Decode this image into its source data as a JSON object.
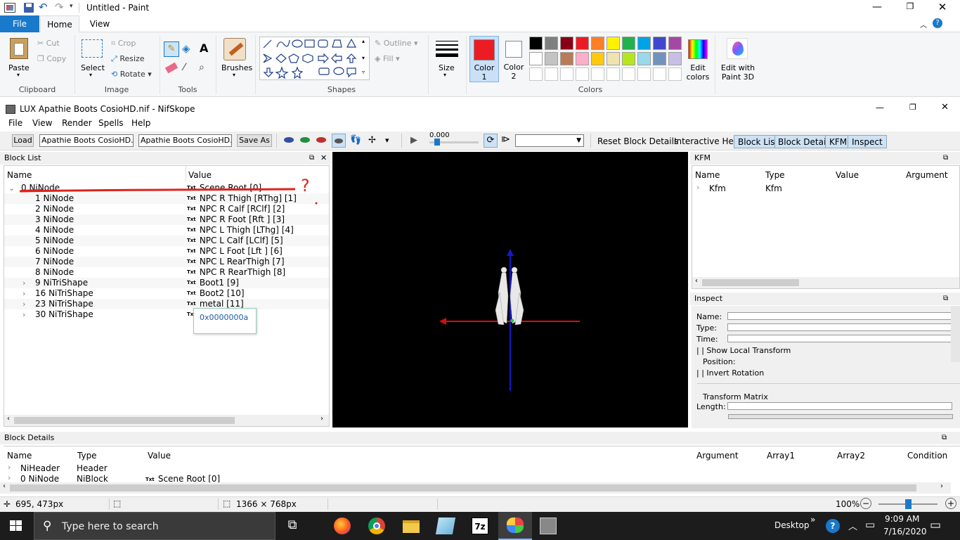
{
  "paint": {
    "title": "Untitled - Paint",
    "tabs": {
      "file": "File",
      "home": "Home",
      "view": "View"
    },
    "clipboard": {
      "paste": "Paste",
      "cut": "Cut",
      "copy": "Copy",
      "label": "Clipboard"
    },
    "image": {
      "select": "Select",
      "crop": "Crop",
      "resize": "Resize",
      "rotate": "Rotate",
      "label": "Image"
    },
    "tools": {
      "label": "Tools"
    },
    "brushes": "Brushes",
    "shapes": {
      "outline": "Outline",
      "fill": "Fill",
      "label": "Shapes"
    },
    "size": "Size",
    "color1": {
      "line1": "Color",
      "line2": "1"
    },
    "color2": {
      "line1": "Color",
      "line2": "2"
    },
    "colors_label": "Colors",
    "edit_colors": {
      "line1": "Edit",
      "line2": "colors"
    },
    "edit_paint3d": {
      "line1": "Edit with",
      "line2": "Paint 3D"
    },
    "palette": [
      "#000000",
      "#7f7f7f",
      "#880015",
      "#ed1c24",
      "#ff7f27",
      "#fff200",
      "#22b14c",
      "#00a2e8",
      "#3f48cc",
      "#a349a4",
      "#ffffff",
      "#c3c3c3",
      "#b97a57",
      "#ffaec9",
      "#ffc90e",
      "#efe4b0",
      "#b5e61d",
      "#99d9ea",
      "#7092be",
      "#c8bfe7"
    ],
    "color1_value": "#ed1c24",
    "status": {
      "coords": "695, 473px",
      "size": "1366 × 768px",
      "zoom": "100%"
    }
  },
  "nifskope": {
    "title": "LUX Apathie Boots CosioHD.nif - NifSkope",
    "menu": [
      "File",
      "View",
      "Render",
      "Spells",
      "Help"
    ],
    "load": "Load",
    "load_field": "Apathie Boots CosioHD.nif",
    "save_field": "Apathie Boots CosioHD.nif",
    "save_as": "Save As",
    "time": "0.000",
    "reset": "Reset Block Details",
    "interactive_help": "Interactive Help",
    "panel_tabs": [
      "Block List",
      "Block Details",
      "KFM",
      "Inspect"
    ],
    "block_list": {
      "title": "Block List",
      "col_name": "Name",
      "col_value": "Value",
      "rows": [
        {
          "name": "0 NiNode",
          "value": "Scene Root [0]",
          "exp": "v"
        },
        {
          "name": "1 NiNode",
          "value": "NPC R Thigh [RThg] [1]",
          "exp": ""
        },
        {
          "name": "2 NiNode",
          "value": "NPC R Calf [RClf] [2]",
          "exp": ""
        },
        {
          "name": "3 NiNode",
          "value": "NPC R Foot [Rft ] [3]",
          "exp": ""
        },
        {
          "name": "4 NiNode",
          "value": "NPC L Thigh [LThg] [4]",
          "exp": ""
        },
        {
          "name": "5 NiNode",
          "value": "NPC L Calf [LClf] [5]",
          "exp": ""
        },
        {
          "name": "6 NiNode",
          "value": "NPC L Foot [Lft ] [6]",
          "exp": ""
        },
        {
          "name": "7 NiNode",
          "value": "NPC L RearThigh [7]",
          "exp": ""
        },
        {
          "name": "8 NiNode",
          "value": "NPC R RearThigh [8]",
          "exp": ""
        },
        {
          "name": "9 NiTriShape",
          "value": "Boot1 [9]",
          "exp": ">"
        },
        {
          "name": "16 NiTriShape",
          "value": "Boot2 [10]",
          "exp": ">"
        },
        {
          "name": "23 NiTriShape",
          "value": "metal [11]",
          "exp": ">"
        },
        {
          "name": "30 NiTriShape",
          "value": "",
          "exp": ">"
        }
      ],
      "tooltip": "0x0000000a"
    },
    "kfm": {
      "title": "KFM",
      "cols": [
        "Name",
        "Type",
        "Value",
        "Argument"
      ],
      "row": {
        "name": "Kfm",
        "type": "Kfm"
      }
    },
    "inspect": {
      "title": "Inspect",
      "name": "Name:",
      "type": "Type:",
      "time": "Time:",
      "show_local": "Show Local Transform",
      "position": "Position:",
      "invert": "Invert Rotation",
      "transform": "Transform Matrix",
      "length": "Length:"
    },
    "block_details": {
      "title": "Block Details",
      "cols": [
        "Name",
        "Type",
        "Value",
        "Argument",
        "Array1",
        "Array2",
        "Condition"
      ],
      "rows": [
        {
          "name": "NiHeader",
          "type": "Header",
          "value": ""
        },
        {
          "name": "0 NiNode",
          "type": "NiBlock",
          "value": "Scene Root [0]"
        }
      ]
    }
  },
  "annotation": "?",
  "taskbar": {
    "search": "Type here to search",
    "desktop": "Desktop",
    "time": "9:09 AM",
    "date": "7/16/2020"
  }
}
